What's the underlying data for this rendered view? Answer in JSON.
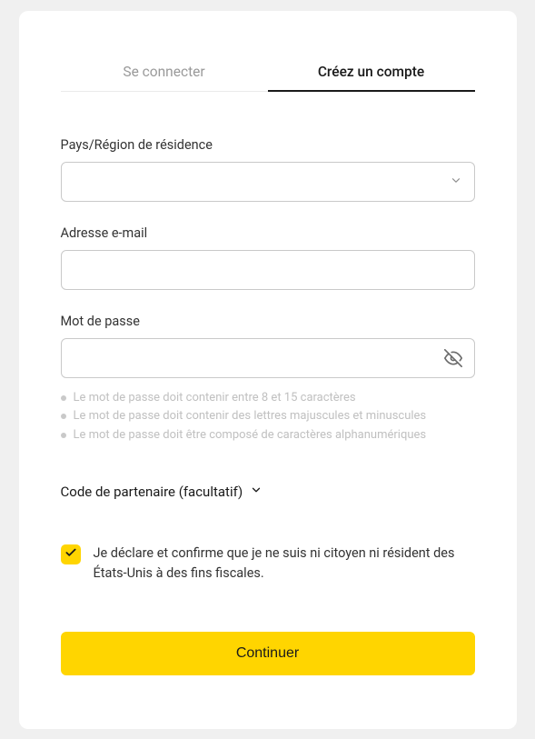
{
  "tabs": {
    "login": "Se connecter",
    "register": "Créez un compte"
  },
  "form": {
    "country_label": "Pays/Région de résidence",
    "country_value": "",
    "email_label": "Adresse e-mail",
    "email_value": "",
    "password_label": "Mot de passe",
    "password_value": "",
    "hints": [
      "Le mot de passe doit contenir entre 8 et 15 caractères",
      "Le mot de passe doit contenir des lettres majuscules et minuscules",
      "Le mot de passe doit être composé de caractères alphanumériques"
    ],
    "partner_code_toggle": "Code de partenaire (facultatif)",
    "declaration_checked": true,
    "declaration_text": "Je déclare et confirme que je ne suis ni citoyen ni résident des États-Unis à des fins fiscales.",
    "continue_label": "Continuer"
  },
  "icons": {
    "chevron_down": "chevron-down-icon",
    "eye_off": "eye-off-icon",
    "check": "check-icon"
  }
}
